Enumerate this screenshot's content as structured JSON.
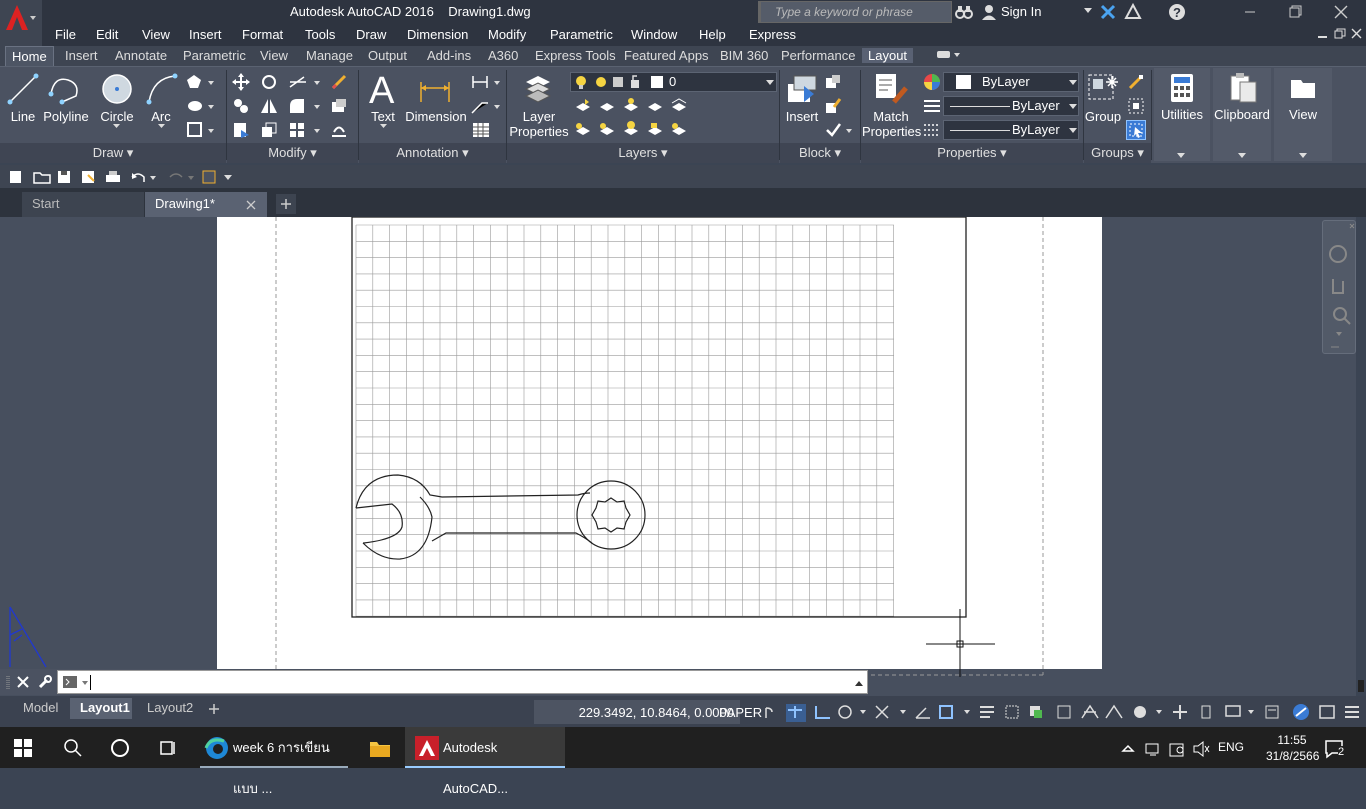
{
  "window": {
    "title": "Autodesk AutoCAD 2016    Drawing1.dwg"
  },
  "search": {
    "placeholder": "Type a keyword or phrase"
  },
  "account": {
    "signin": "Sign In"
  },
  "menu": [
    "File",
    "Edit",
    "View",
    "Insert",
    "Format",
    "Tools",
    "Draw",
    "Dimension",
    "Modify",
    "Parametric",
    "Window",
    "Help",
    "Express"
  ],
  "ribbon_tabs": [
    "Home",
    "Insert",
    "Annotate",
    "Parametric",
    "View",
    "Manage",
    "Output",
    "Add-ins",
    "A360",
    "Express Tools",
    "Featured Apps",
    "BIM 360",
    "Performance",
    "Layout"
  ],
  "ribbon": {
    "draw": {
      "line": "Line",
      "polyline": "Polyline",
      "circle": "Circle",
      "arc": "Arc",
      "panel": "Draw"
    },
    "modify": {
      "panel": "Modify"
    },
    "annotation": {
      "text": "Text",
      "dimension": "Dimension",
      "panel": "Annotation"
    },
    "layers": {
      "layer_properties_1": "Layer",
      "layer_properties_2": "Properties",
      "current_layer": "0",
      "panel": "Layers"
    },
    "block": {
      "insert": "Insert",
      "panel": "Block"
    },
    "properties": {
      "match_1": "Match",
      "match_2": "Properties",
      "color": "ByLayer",
      "linetype": "ByLayer",
      "lineweight": "ByLayer",
      "panel": "Properties"
    },
    "groups": {
      "group": "Group",
      "panel": "Groups"
    },
    "utilities": "Utilities",
    "clipboard": "Clipboard",
    "view": "View"
  },
  "doc_tabs": {
    "start": "Start",
    "drawing": "Drawing1*"
  },
  "layout_tabs": [
    "Model",
    "Layout1",
    "Layout2"
  ],
  "status": {
    "coords": "229.3492, 10.8464, 0.0000",
    "space": "PAPER"
  },
  "taskbar": {
    "browser_item": "week 6 การเขียนแบบ ...",
    "autocad_item": "Autodesk AutoCAD...",
    "lang": "ENG",
    "time": "11:55",
    "date": "31/8/2566",
    "notifications": "2"
  }
}
